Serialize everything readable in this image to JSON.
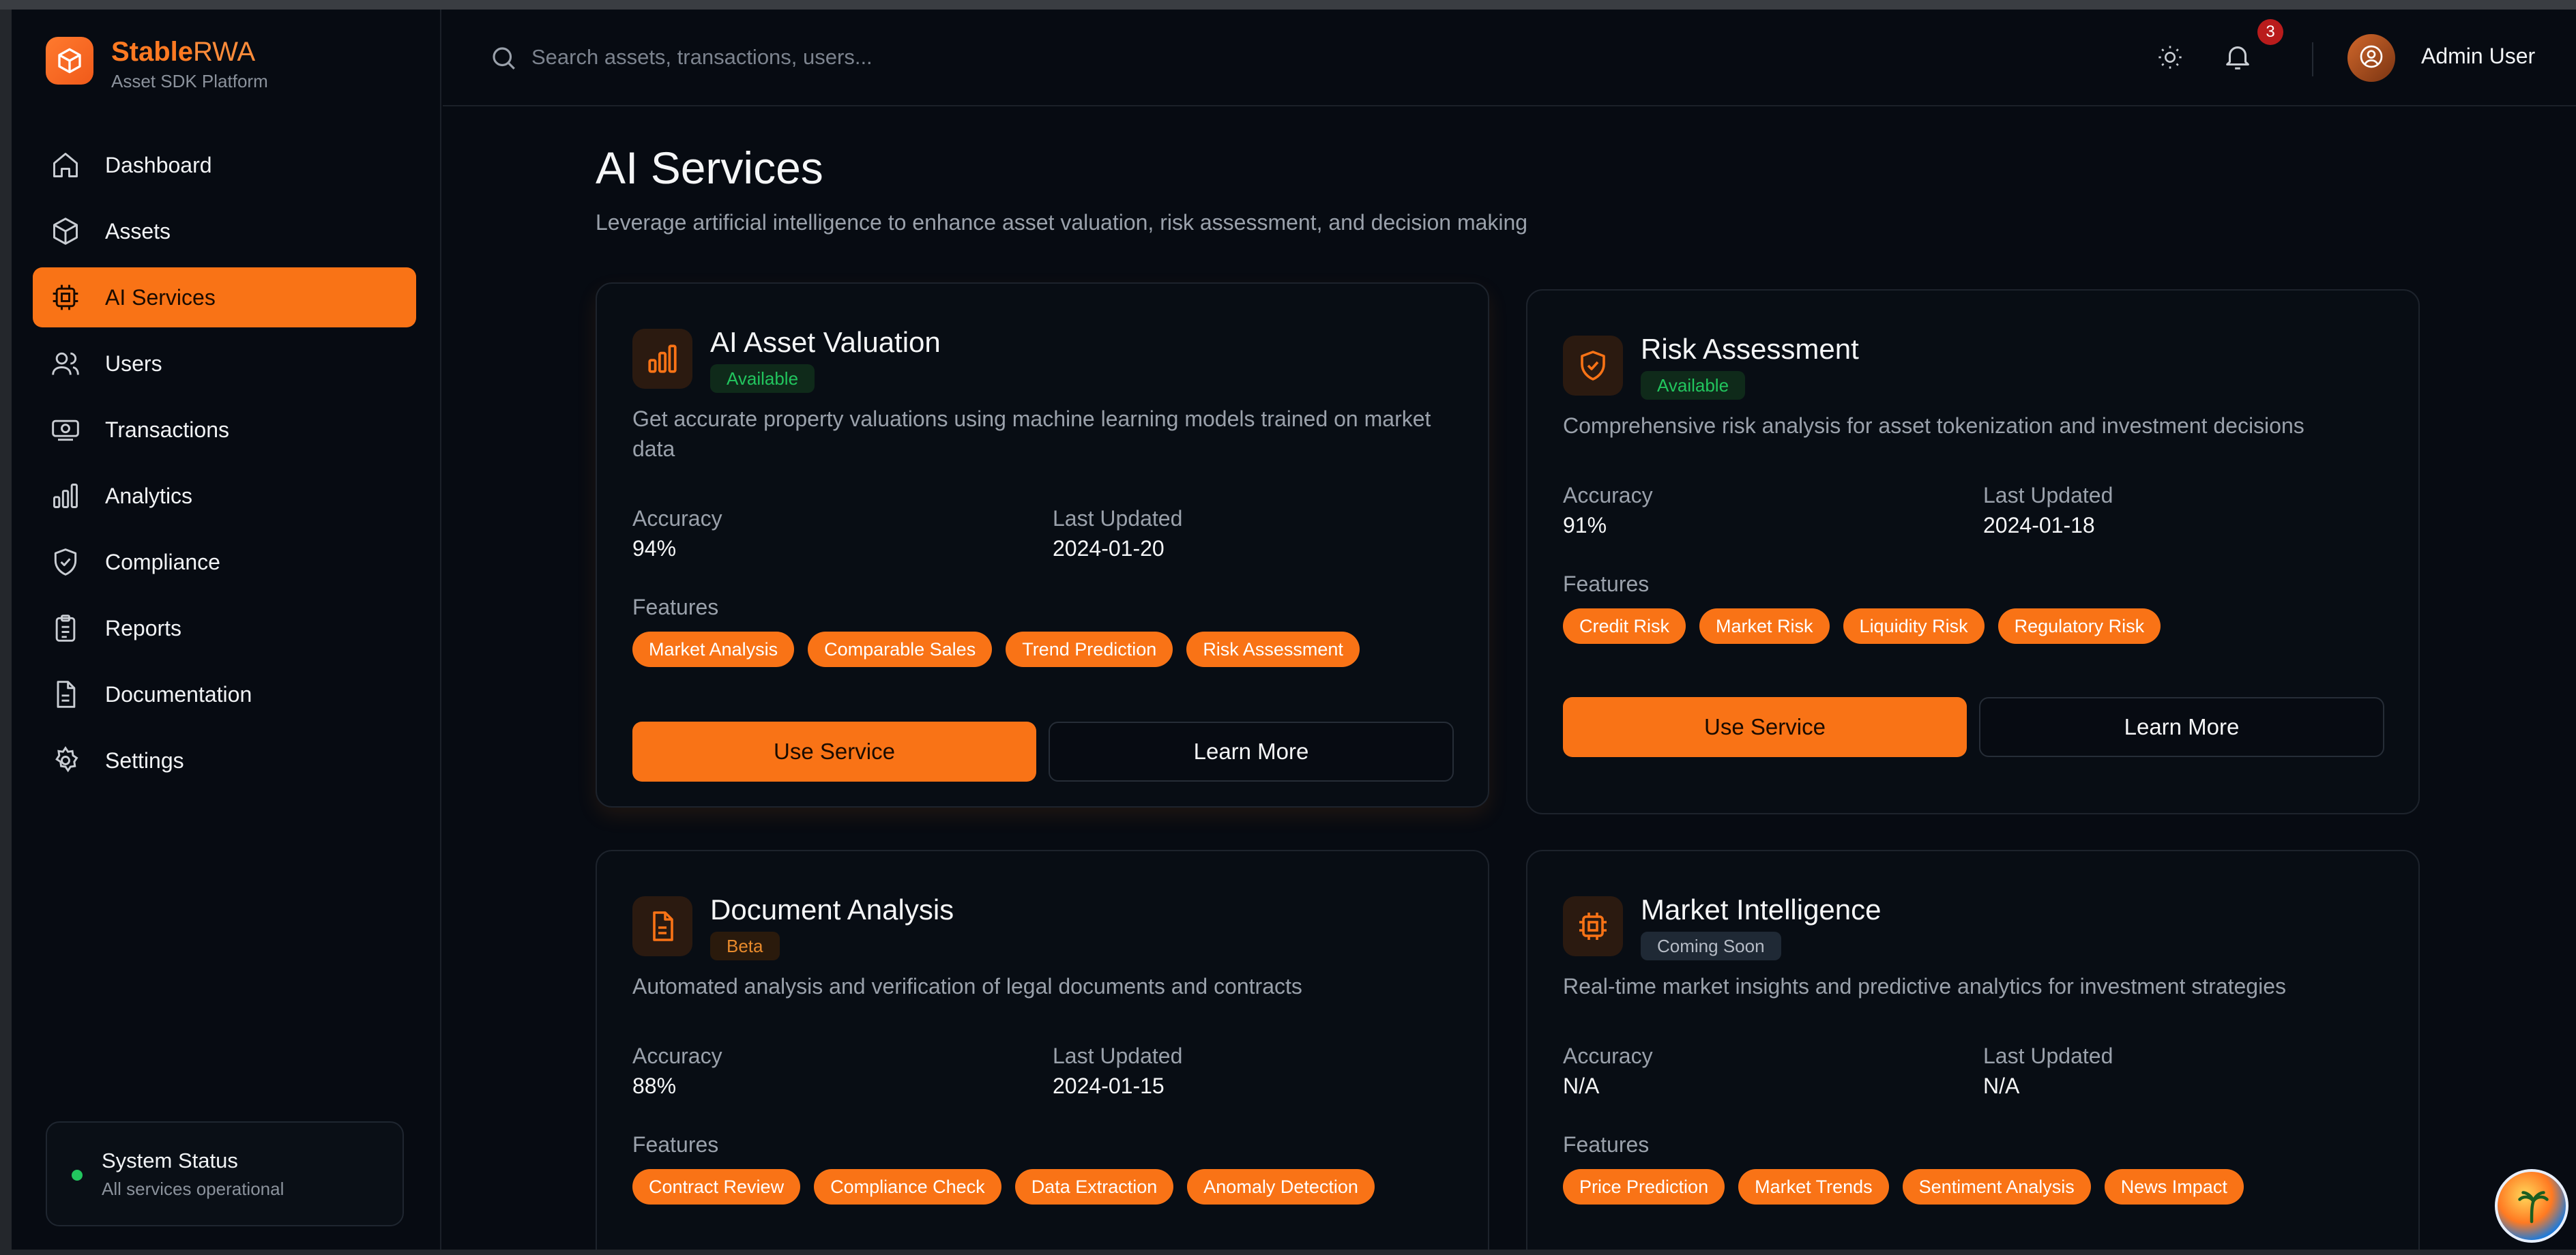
{
  "brand": {
    "name_main": "Stable",
    "name_accent": "RWA",
    "subtitle": "Asset SDK Platform"
  },
  "sidebar": {
    "items": [
      {
        "label": "Dashboard",
        "icon": "home-icon",
        "active": false
      },
      {
        "label": "Assets",
        "icon": "cube-icon",
        "active": false
      },
      {
        "label": "AI Services",
        "icon": "cpu-icon",
        "active": true
      },
      {
        "label": "Users",
        "icon": "users-icon",
        "active": false
      },
      {
        "label": "Transactions",
        "icon": "banknote-icon",
        "active": false
      },
      {
        "label": "Analytics",
        "icon": "bar-chart-icon",
        "active": false
      },
      {
        "label": "Compliance",
        "icon": "shield-check-icon",
        "active": false
      },
      {
        "label": "Reports",
        "icon": "clipboard-icon",
        "active": false
      },
      {
        "label": "Documentation",
        "icon": "file-text-icon",
        "active": false
      },
      {
        "label": "Settings",
        "icon": "gear-icon",
        "active": false
      }
    ],
    "system_status": {
      "title": "System Status",
      "subtitle": "All services operational"
    }
  },
  "header": {
    "search_placeholder": "Search assets, transactions, users...",
    "notification_count": "3",
    "user_name": "Admin User"
  },
  "page": {
    "title": "AI Services",
    "subtitle": "Leverage artificial intelligence to enhance asset valuation, risk assessment, and decision making"
  },
  "services": [
    {
      "title": "AI Asset Valuation",
      "icon": "bar-chart-icon",
      "status": "Available",
      "description": "Get accurate property valuations using machine learning models trained on market data",
      "accuracy_label": "Accuracy",
      "accuracy": "94%",
      "updated_label": "Last Updated",
      "updated": "2024-01-20",
      "features_label": "Features",
      "features": [
        "Market Analysis",
        "Comparable Sales",
        "Trend Prediction",
        "Risk Assessment"
      ],
      "primary_button": "Use Service",
      "secondary_button": "Learn More"
    },
    {
      "title": "Risk Assessment",
      "icon": "shield-check-icon",
      "status": "Available",
      "description": "Comprehensive risk analysis for asset tokenization and investment decisions",
      "accuracy_label": "Accuracy",
      "accuracy": "91%",
      "updated_label": "Last Updated",
      "updated": "2024-01-18",
      "features_label": "Features",
      "features": [
        "Credit Risk",
        "Market Risk",
        "Liquidity Risk",
        "Regulatory Risk"
      ],
      "primary_button": "Use Service",
      "secondary_button": "Learn More"
    },
    {
      "title": "Document Analysis",
      "icon": "file-text-icon",
      "status": "Beta",
      "description": "Automated analysis and verification of legal documents and contracts",
      "accuracy_label": "Accuracy",
      "accuracy": "88%",
      "updated_label": "Last Updated",
      "updated": "2024-01-15",
      "features_label": "Features",
      "features": [
        "Contract Review",
        "Compliance Check",
        "Data Extraction",
        "Anomaly Detection"
      ]
    },
    {
      "title": "Market Intelligence",
      "icon": "cpu-icon",
      "status": "Coming Soon",
      "description": "Real-time market insights and predictive analytics for investment strategies",
      "accuracy_label": "Accuracy",
      "accuracy": "N/A",
      "updated_label": "Last Updated",
      "updated": "N/A",
      "features_label": "Features",
      "features": [
        "Price Prediction",
        "Market Trends",
        "Sentiment Analysis",
        "News Impact"
      ]
    }
  ],
  "colors": {
    "accent": "#f97316",
    "background": "#070b12",
    "available": "#22c55e"
  }
}
